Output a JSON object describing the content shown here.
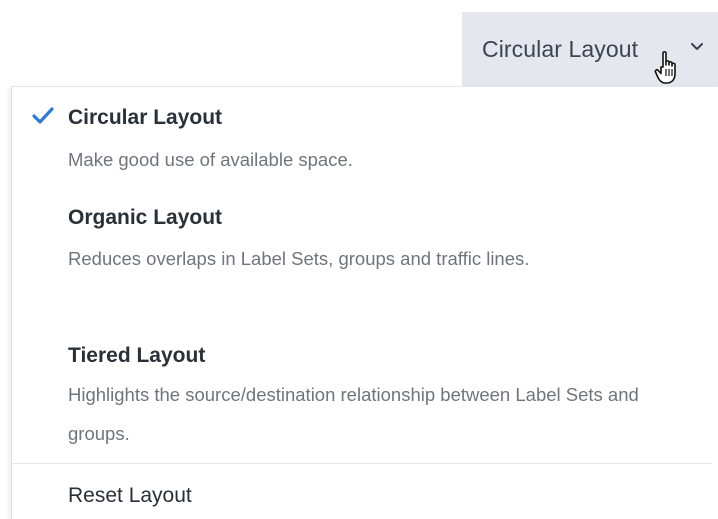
{
  "dropdown": {
    "selected_label": "Circular Layout",
    "chevron_icon": "chevron-down-icon"
  },
  "cursor": {
    "icon": "hand-pointer-icon"
  },
  "menu": {
    "items": [
      {
        "title": "Circular Layout",
        "description": "Make good use of available space.",
        "checked": true,
        "check_icon": "checkmark-icon",
        "check_color": "#2f7bd0"
      },
      {
        "title": "Organic Layout",
        "description": "Reduces overlaps in Label Sets, groups and traffic lines.",
        "checked": false
      },
      {
        "title": "Tiered Layout",
        "description": "Highlights the source/destination relationship between Label Sets and groups.",
        "checked": false
      }
    ],
    "reset_label": "Reset Layout"
  }
}
